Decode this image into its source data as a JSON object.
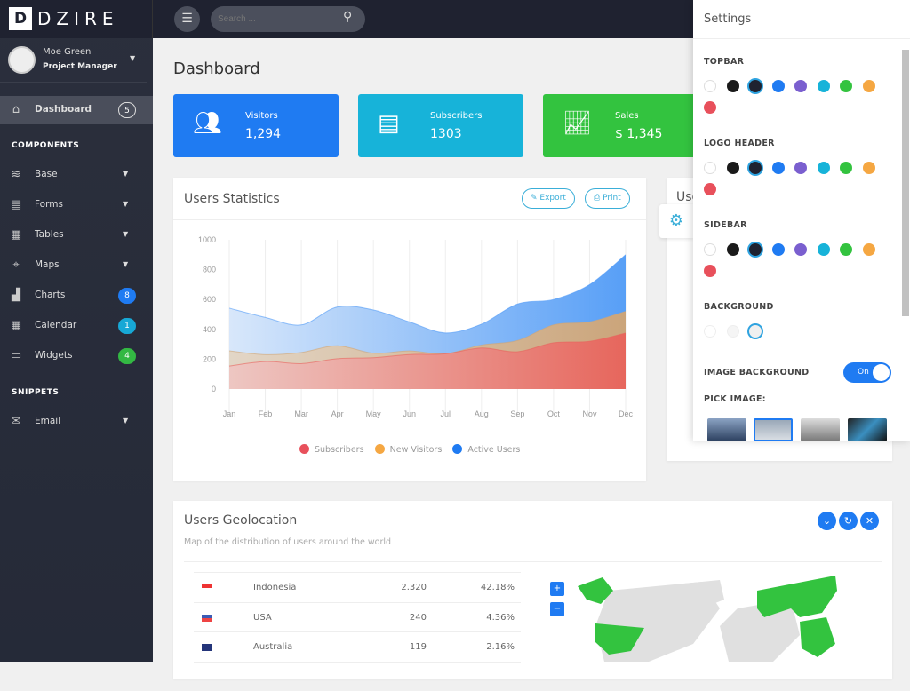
{
  "logo": {
    "mark": "D",
    "text": "DZIRE"
  },
  "user": {
    "name": "Moe Green",
    "role": "Project Manager"
  },
  "sidebar": {
    "dashboard": {
      "label": "Dashboard",
      "badge": "5"
    },
    "sections": [
      "COMPONENTS",
      "SNIPPETS"
    ],
    "items": [
      {
        "label": "Base",
        "icon": "layers-icon",
        "caret": true
      },
      {
        "label": "Forms",
        "icon": "forms-icon",
        "caret": true
      },
      {
        "label": "Tables",
        "icon": "tables-icon",
        "caret": true
      },
      {
        "label": "Maps",
        "icon": "map-pin-icon",
        "caret": true
      },
      {
        "label": "Charts",
        "icon": "chart-icon",
        "badge": "8",
        "badge_color": "#1f7bf2"
      },
      {
        "label": "Calendar",
        "icon": "calendar-icon",
        "badge": "1",
        "badge_color": "#17a8d6"
      },
      {
        "label": "Widgets",
        "icon": "widgets-icon",
        "badge": "4",
        "badge_color": "#33b843"
      },
      {
        "label": "Email",
        "icon": "mailbox-icon",
        "caret": true
      }
    ]
  },
  "topbar": {
    "search_placeholder": "Search ..."
  },
  "page_title": "Dashboard",
  "stats": [
    {
      "label": "Visitors",
      "value": "1,294",
      "color": "#1f7bf2",
      "icon": "users-icon"
    },
    {
      "label": "Subscribers",
      "value": "1303",
      "color": "#17b3d9",
      "icon": "newspaper-icon"
    },
    {
      "label": "Sales",
      "value": "$ 1,345",
      "color": "#33c33f",
      "icon": "growth-chart-icon"
    }
  ],
  "users_statistics": {
    "title": "Users Statistics",
    "export_label": "Export",
    "print_label": "Print"
  },
  "right_card_title": "Use",
  "chart_data": {
    "type": "area",
    "categories": [
      "Jan",
      "Feb",
      "Mar",
      "Apr",
      "May",
      "Jun",
      "Jul",
      "Aug",
      "Sep",
      "Oct",
      "Nov",
      "Dec"
    ],
    "ylim": [
      0,
      1000
    ],
    "yticks": [
      0,
      200,
      400,
      600,
      800,
      1000
    ],
    "grid": true,
    "legend": "bottom",
    "series": [
      {
        "name": "Subscribers",
        "color": "#e8625a",
        "values": [
          154,
          184,
          170,
          203,
          210,
          231,
          236,
          275,
          250,
          310,
          320,
          375
        ]
      },
      {
        "name": "New Visitors",
        "color": "#f5a742",
        "values": [
          256,
          230,
          245,
          290,
          240,
          255,
          236,
          295,
          325,
          430,
          450,
          520
        ]
      },
      {
        "name": "Active Users",
        "color": "#1f7bf2",
        "values": [
          542,
          480,
          430,
          550,
          530,
          450,
          376,
          435,
          570,
          600,
          700,
          900
        ]
      }
    ]
  },
  "geolocation": {
    "title": "Users Geolocation",
    "subtitle": "Map of the distribution of users around the world",
    "rows": [
      {
        "country": "Indonesia",
        "users": "2.320",
        "percent": "42.18%",
        "flag": "indonesia-flag-icon"
      },
      {
        "country": "USA",
        "users": "240",
        "percent": "4.36%",
        "flag": "usa-flag-icon"
      },
      {
        "country": "Australia",
        "users": "119",
        "percent": "2.16%",
        "flag": "australia-flag-icon"
      }
    ],
    "zoom_in": "+",
    "zoom_out": "−"
  },
  "settings": {
    "title": "Settings",
    "topbar_label": "TOPBAR",
    "logo_header_label": "LOGO HEADER",
    "sidebar_label": "SIDEBAR",
    "background_label": "BACKGROUND",
    "image_background_label": "IMAGE BACKGROUND",
    "toggle_label": "On",
    "pick_image_label": "PICK IMAGE:",
    "swatches": [
      "#ffffff",
      "#1a1a1a",
      "#1f2230",
      "#1f7bf2",
      "#7a5fcf",
      "#17b3d9",
      "#33c33f",
      "#f5a742",
      "#e8505b"
    ],
    "background_swatches": [
      "#ffffff",
      "#f5f5f5",
      "#f0f0f0"
    ],
    "selected_swatch": 2,
    "selected_background": 2,
    "image_background_on": true
  }
}
